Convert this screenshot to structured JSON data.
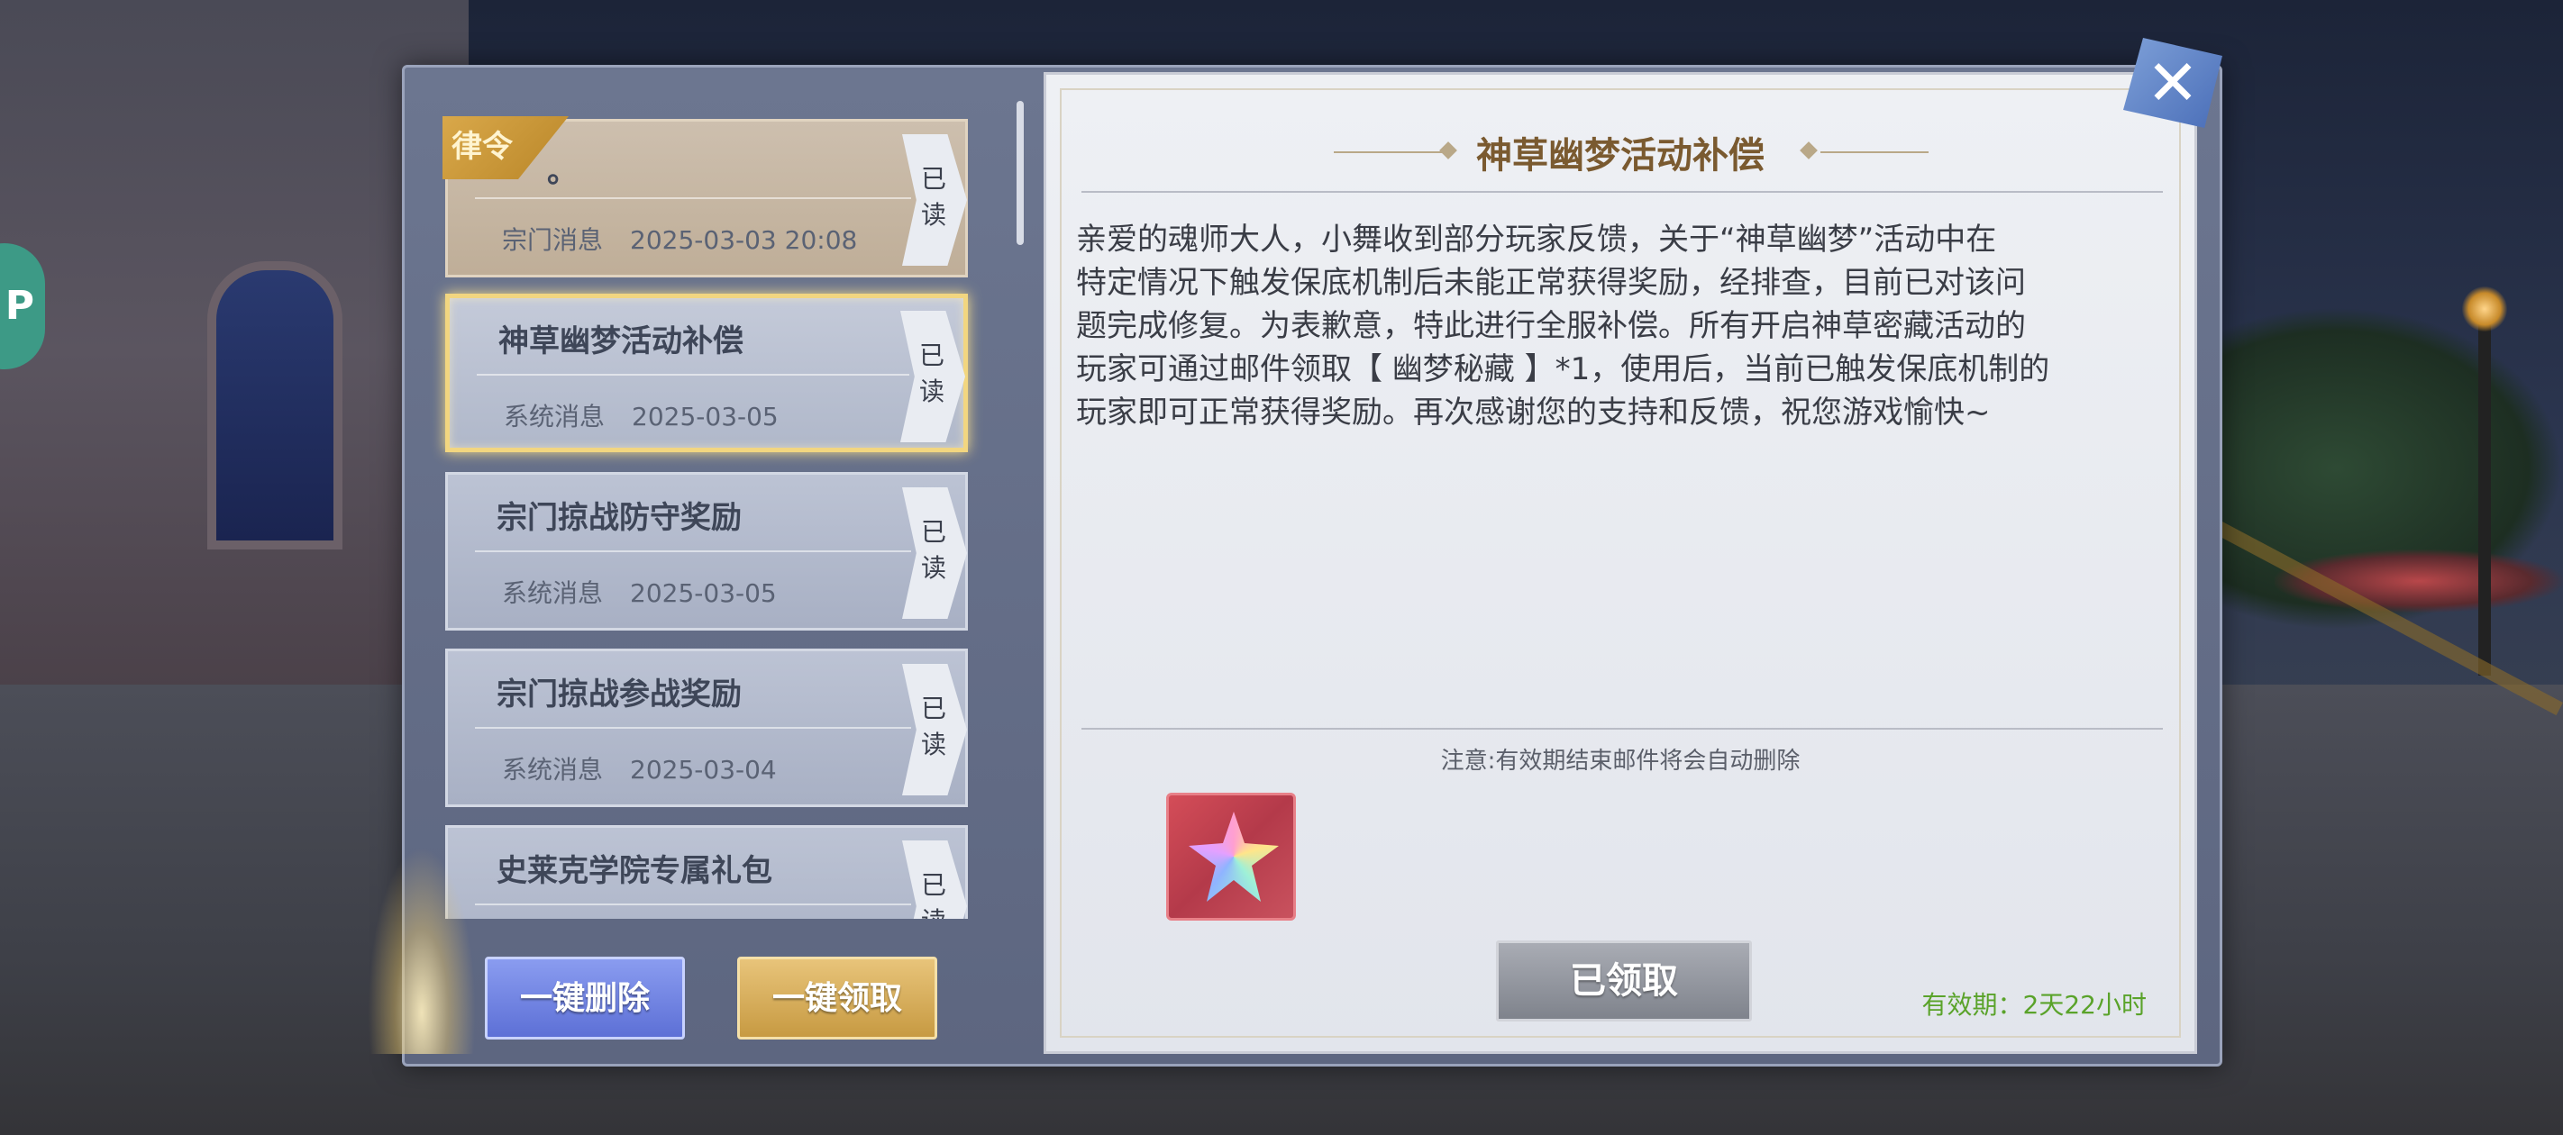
{
  "side_badge": "P",
  "mail_list": [
    {
      "badge": "律令",
      "title": "。",
      "type": "宗门消息",
      "date": "2025-03-03 20:08",
      "read": "已读"
    },
    {
      "title": "神草幽梦活动补偿",
      "type": "系统消息",
      "date": "2025-03-05",
      "read": "已读"
    },
    {
      "title": "宗门掠战防守奖励",
      "type": "系统消息",
      "date": "2025-03-05",
      "read": "已读"
    },
    {
      "title": "宗门掠战参战奖励",
      "type": "系统消息",
      "date": "2025-03-04",
      "read": "已读"
    },
    {
      "title": "史莱克学院专属礼包",
      "read": "已读"
    }
  ],
  "buttons": {
    "delete_all": "一键删除",
    "claim_all": "一键领取"
  },
  "detail": {
    "title": "神草幽梦活动补偿",
    "body_lines": [
      "亲爱的魂师大人，小舞收到部分玩家反馈，关于“神草幽梦”活动中在",
      "特定情况下触发保底机制后未能正常获得奖励，经排查，目前已对该问",
      "题完成修复。为表歉意，特此进行全服补偿。所有开启神草密藏活动的",
      "玩家可通过邮件领取【 幽梦秘藏 】*1，使用后，当前已触发保底机制的",
      "玩家即可正常获得奖励。再次感谢您的支持和反馈，祝您游戏愉快~"
    ],
    "note": "注意:有效期结束邮件将会自动删除",
    "attachment_icon": "dream-treasure-crystal-icon",
    "claimed_label": "已领取",
    "validity": "有效期：2天22小时"
  },
  "colors": {
    "validity": "#5aa32a",
    "selected_border": "#f2d680",
    "title": "#7a5a30"
  }
}
